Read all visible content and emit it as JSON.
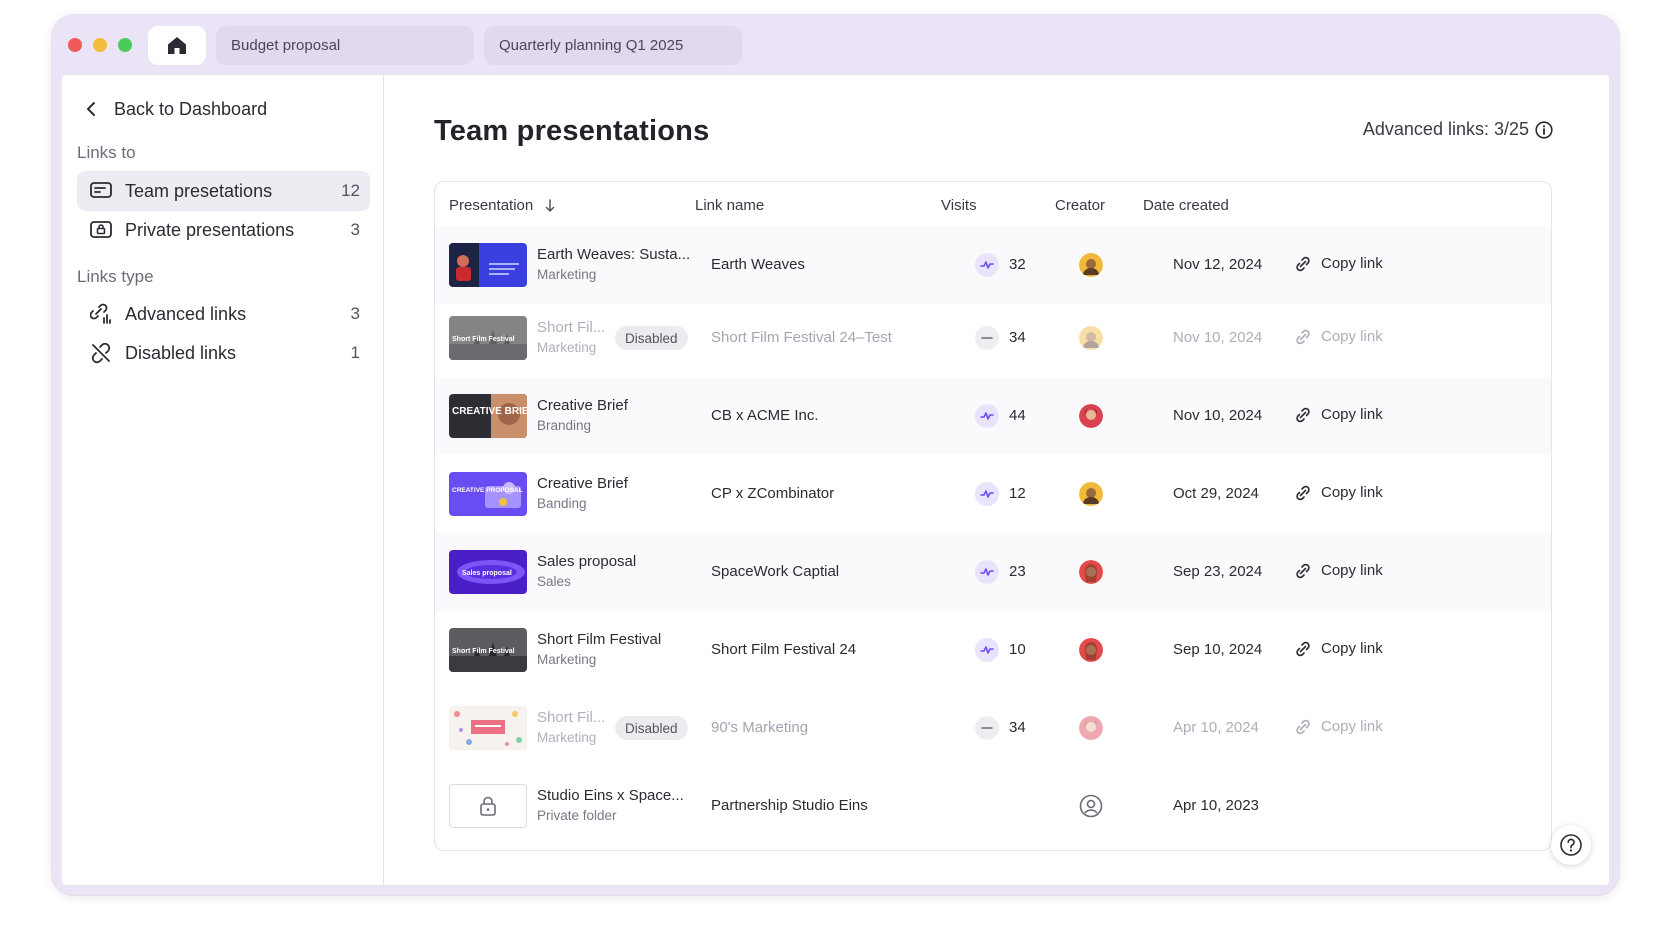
{
  "tabs": {
    "home_icon": "home-icon",
    "items": [
      {
        "label": "Budget proposal"
      },
      {
        "label": "Quarterly planning Q1 2025"
      }
    ]
  },
  "sidebar": {
    "back_label": "Back to Dashboard",
    "links_to_label": "Links to",
    "links_to_items": [
      {
        "label": "Team presetations",
        "count": "12",
        "icon": "presentation-icon",
        "active": true
      },
      {
        "label": "Private presentations",
        "count": "3",
        "icon": "lock-presentation-icon",
        "active": false
      }
    ],
    "links_type_label": "Links type",
    "links_type_items": [
      {
        "label": "Advanced links",
        "count": "3",
        "icon": "link-analytics-icon"
      },
      {
        "label": "Disabled links",
        "count": "1",
        "icon": "link-off-icon"
      }
    ]
  },
  "main": {
    "title": "Team presentations",
    "advanced_links": "Advanced links: 3/25"
  },
  "table": {
    "columns": [
      "Presentation",
      "Link name",
      "Visits",
      "Creator",
      "Date created"
    ],
    "sort_column": "Presentation",
    "rows": [
      {
        "title": "Earth Weaves: Susta...",
        "category": "Marketing",
        "link_name": "Earth Weaves",
        "visits": "32",
        "date": "Nov 12, 2024",
        "action": "Copy link",
        "status": "active",
        "thumb": "earth"
      },
      {
        "title": "Short Fil...",
        "category": "Marketing",
        "badge": "Disabled",
        "link_name": "Short Film Festival 24–Test",
        "visits": "34",
        "date": "Nov 10, 2024",
        "action": "Copy link",
        "status": "disabled",
        "thumb": "film"
      },
      {
        "title": "Creative Brief",
        "category": "Branding",
        "link_name": "CB x ACME Inc.",
        "visits": "44",
        "date": "Nov 10, 2024",
        "action": "Copy link",
        "status": "active",
        "thumb": "brief"
      },
      {
        "title": "Creative Brief",
        "category": "Banding",
        "link_name": "CP x ZCombinator",
        "visits": "12",
        "date": "Oct 29, 2024",
        "action": "Copy link",
        "status": "active",
        "thumb": "proposal"
      },
      {
        "title": "Sales proposal",
        "category": "Sales",
        "link_name": "SpaceWork Captial",
        "visits": "23",
        "date": "Sep 23, 2024",
        "action": "Copy link",
        "status": "active",
        "thumb": "sales"
      },
      {
        "title": "Short Film Festival",
        "category": "Marketing",
        "link_name": "Short Film Festival 24",
        "visits": "10",
        "date": "Sep 10, 2024",
        "action": "Copy link",
        "status": "active",
        "thumb": "film"
      },
      {
        "title": "Short Fil...",
        "category": "Marketing",
        "badge": "Disabled",
        "link_name": "90's Marketing",
        "visits": "34",
        "date": "Apr 10, 2024",
        "action": "Copy link",
        "status": "disabled",
        "thumb": "pattern"
      },
      {
        "title": "Studio Eins x Space...",
        "category": "Private folder",
        "link_name": "Partnership Studio Eins",
        "visits": "",
        "date": "Apr 10, 2023",
        "action": "",
        "status": "private",
        "thumb": "lock"
      }
    ],
    "thumb_text": {
      "film": "Short Film Festival",
      "brief": "CREATIVE BRIEF",
      "proposal": "CREATIVE PROPOSAL",
      "sales": "Sales proposal"
    }
  },
  "colors": {
    "window_bg": "#ebe4f6",
    "accent": "#6b4ff5",
    "active_nav": "#eeecf2"
  }
}
